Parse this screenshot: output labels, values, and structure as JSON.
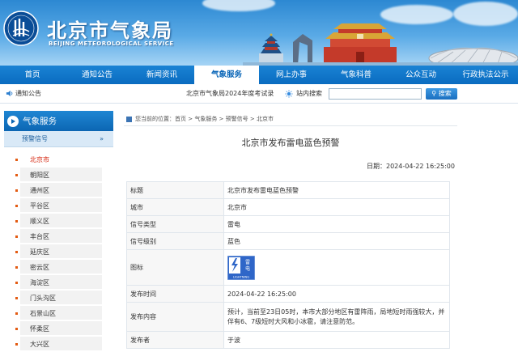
{
  "header": {
    "site_title": "北京市气象局",
    "site_subtitle": "BEIJING METEOROLOGICAL SERVICE"
  },
  "nav": {
    "items": [
      {
        "label": "首页"
      },
      {
        "label": "通知公告"
      },
      {
        "label": "新闻资讯"
      },
      {
        "label": "气象服务",
        "active": true
      },
      {
        "label": "网上办事"
      },
      {
        "label": "气象科普"
      },
      {
        "label": "公众互动"
      },
      {
        "label": "行政执法公示"
      }
    ]
  },
  "subbar": {
    "notice_label": "通知公告",
    "marquee": "北京市气象局2024年度考试录",
    "site_search_label": "站内搜索",
    "search_button": "搜索"
  },
  "sidebar": {
    "heading": "气象服务",
    "section": "预警信号",
    "section_arrow": "»",
    "items": [
      "北京市",
      "朝阳区",
      "通州区",
      "平谷区",
      "顺义区",
      "丰台区",
      "延庆区",
      "密云区",
      "海淀区",
      "门头沟区",
      "石景山区",
      "怀柔区",
      "大兴区"
    ]
  },
  "main": {
    "breadcrumb": "您当前的位置：首页 > 气象服务 > 预警信号 > 北京市",
    "title": "北京市发布雷电蓝色预警",
    "date": "日期：2024-04-22 16:25:00",
    "table": {
      "title_k": "标题",
      "title_v": "北京市发布雷电蓝色预警",
      "city_k": "城市",
      "city_v": "北京市",
      "type_k": "信号类型",
      "type_v": "雷电",
      "level_k": "信号级别",
      "level_v": "蓝色",
      "icon_k": "图标",
      "icon_text_cn": "雷电",
      "icon_text_en": "LIGHTNING",
      "time_k": "发布时间",
      "time_v": "2024-04-22 16:25:00",
      "content_k": "发布内容",
      "content_v": "预计，当前至23日05时，本市大部分地区有雷阵雨，局地短时雨强较大，并伴有6、7级短时大风和小冰雹，请注意防范。",
      "publisher_k": "发布者",
      "publisher_v": "于波"
    }
  },
  "colors": {
    "nav_blue": "#0a6cc0",
    "warning_blue": "#2f66c8",
    "current_red": "#d6260f"
  }
}
